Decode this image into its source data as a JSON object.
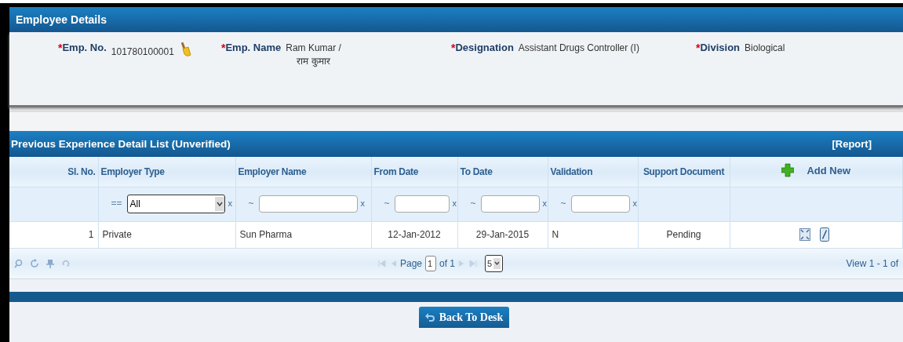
{
  "employee_panel": {
    "title": "Employee Details",
    "fields": [
      {
        "required_mark": "*",
        "label": "Emp. No.",
        "value_lines": [
          "101780100001"
        ],
        "has_clear_icon": true
      },
      {
        "required_mark": "*",
        "label": "Emp. Name",
        "value_lines": [
          "Ram Kumar /",
          "राम कुमार"
        ],
        "has_clear_icon": false
      },
      {
        "required_mark": "*",
        "label": "Designation",
        "value_lines": [
          "Assistant Drugs Controller (I)"
        ],
        "has_clear_icon": false
      },
      {
        "required_mark": "*",
        "label": "Division",
        "value_lines": [
          "Biological"
        ],
        "has_clear_icon": false
      }
    ]
  },
  "experience_list": {
    "title": "Previous Experience Detail List (Unverified)",
    "report_link": "[Report]",
    "columns": [
      "Sl. No.",
      "Employer Type",
      "Employer Name",
      "From Date",
      "To Date",
      "Validation",
      "Support Document"
    ],
    "add_new": "Add New",
    "filters": [
      {
        "kind": "none"
      },
      {
        "kind": "select",
        "operator": "==",
        "value": "All",
        "clear": "x"
      },
      {
        "kind": "text",
        "operator": "~",
        "clear": "x"
      },
      {
        "kind": "text",
        "operator": "~",
        "clear": "x"
      },
      {
        "kind": "text",
        "operator": "~",
        "clear": "x"
      },
      {
        "kind": "text",
        "operator": "~",
        "clear": "x"
      },
      {
        "kind": "none"
      }
    ],
    "rows": [
      {
        "cells": [
          "1",
          "Private",
          "Sun Pharma",
          "12-Jan-2012",
          "29-Jan-2015",
          "N",
          "Pending"
        ]
      }
    ],
    "pager": {
      "page_label": "Page",
      "page": "1",
      "of_label": "of 1",
      "page_size": "5",
      "view_text": "View 1 - 1 of"
    }
  },
  "back_button": {
    "label": "Back To Desk"
  }
}
